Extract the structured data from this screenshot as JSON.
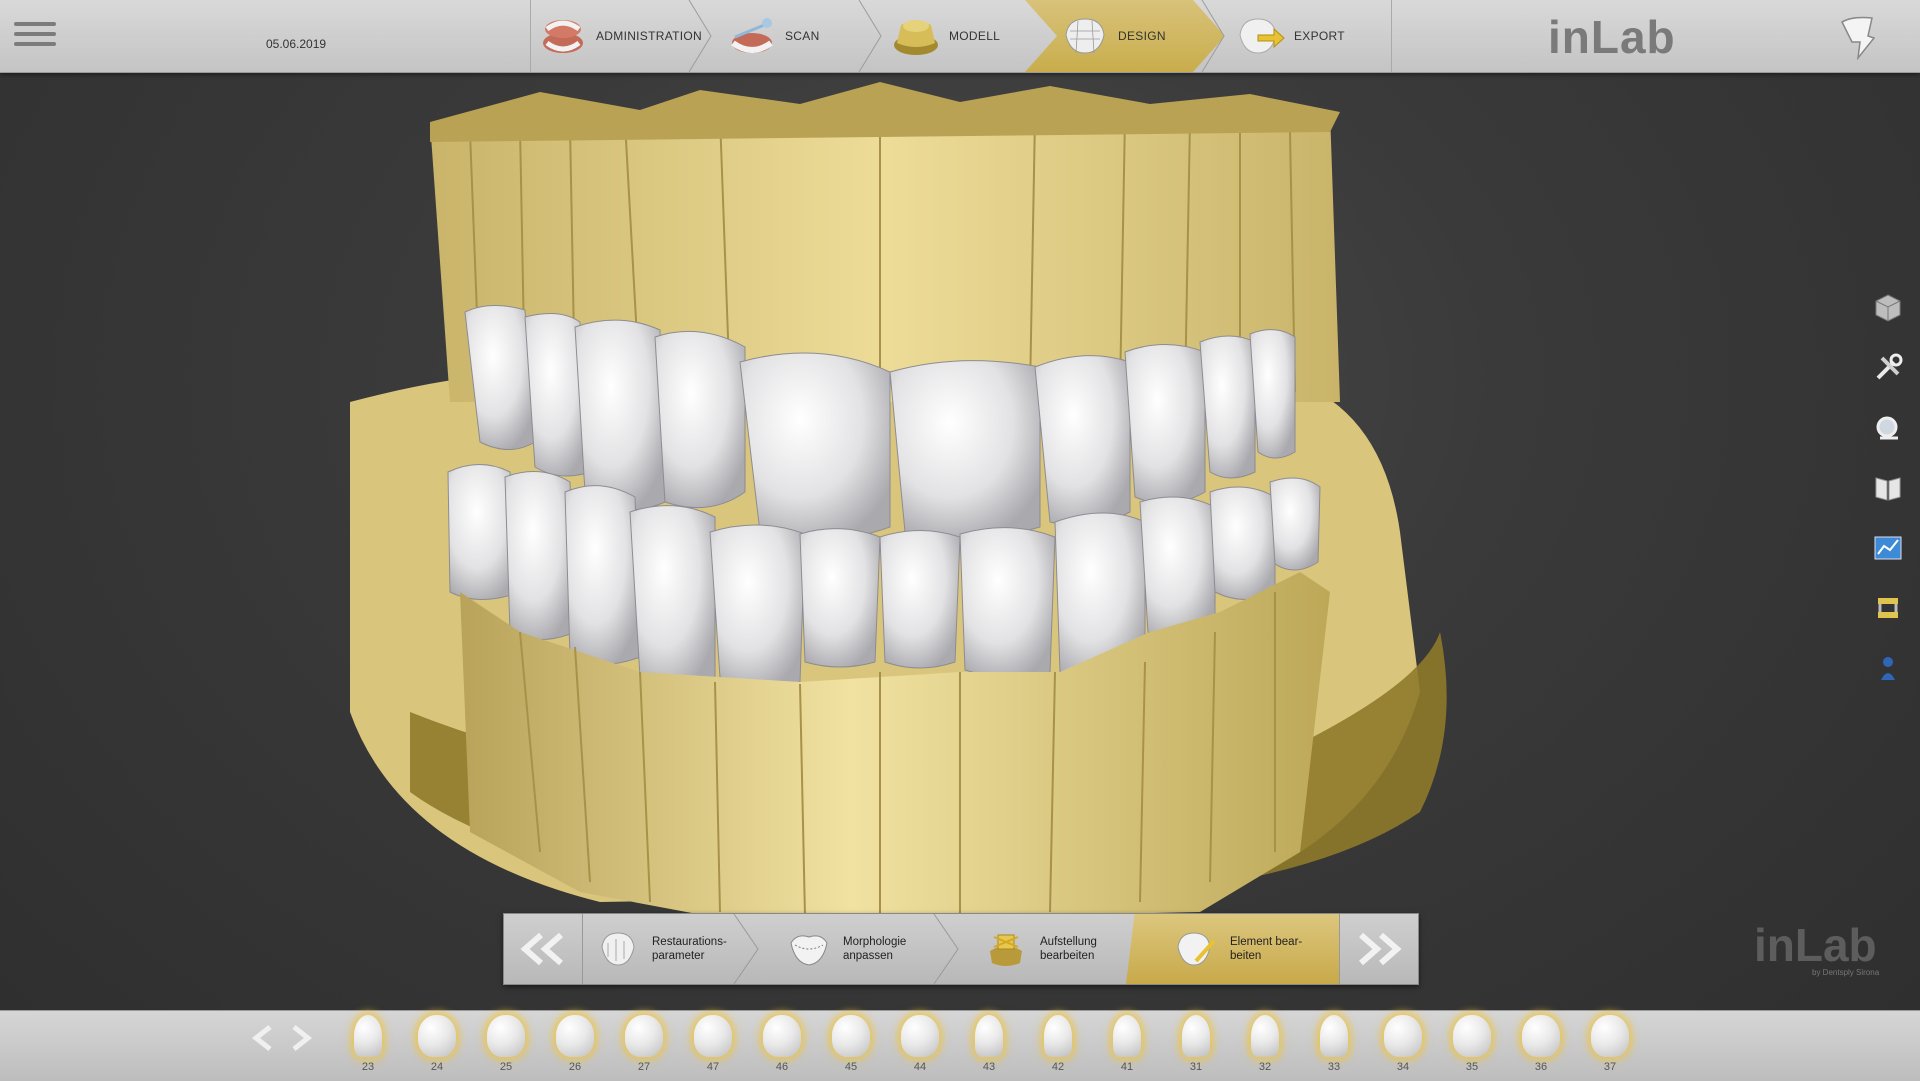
{
  "header": {
    "date": "05.06.2019",
    "brand": "inLab",
    "steps": [
      {
        "label": "ADMINISTRATION",
        "icon": "administration-icon"
      },
      {
        "label": "SCAN",
        "icon": "scan-icon"
      },
      {
        "label": "MODELL",
        "icon": "model-icon"
      },
      {
        "label": "DESIGN",
        "icon": "design-icon",
        "active": true
      },
      {
        "label": "EXPORT",
        "icon": "export-icon"
      }
    ]
  },
  "right_toolbar": [
    "cube-view-icon",
    "tools-icon",
    "magnifier-icon",
    "catalog-icon",
    "chart-icon",
    "articulator-icon",
    "figure-icon"
  ],
  "workflow": {
    "items": [
      {
        "label": "Restaurations-\nparameter",
        "icon": "restoration-parameter-icon"
      },
      {
        "label": "Morphologie\nanpassen",
        "icon": "morphology-icon"
      },
      {
        "label": "Aufstellung\nbearbeiten",
        "icon": "setup-icon"
      },
      {
        "label": "Element bear-\nbeiten",
        "icon": "edit-element-icon",
        "active": true
      }
    ]
  },
  "brand_watermark": {
    "text": "inLab",
    "sub": "by Dentsply Sirona"
  },
  "teeth": [
    "23",
    "24",
    "25",
    "26",
    "27",
    "47",
    "46",
    "45",
    "44",
    "43",
    "42",
    "41",
    "31",
    "32",
    "33",
    "34",
    "35",
    "36",
    "37"
  ],
  "colors": {
    "accent": "#c9ad4c",
    "model": "#e8d48e",
    "crown": "#e6e6e8"
  }
}
